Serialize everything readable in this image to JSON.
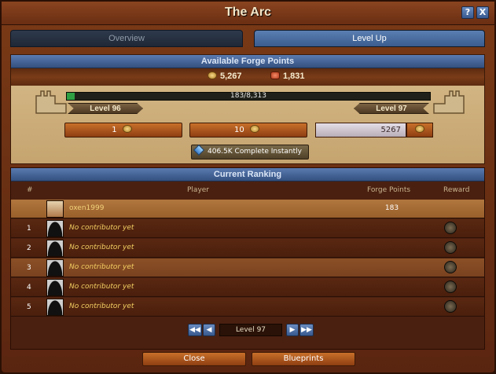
{
  "window": {
    "title": "The Arc",
    "help_label": "?",
    "close_label": "X"
  },
  "tabs": [
    {
      "label": "Overview",
      "active": false
    },
    {
      "label": "Level Up",
      "active": true
    }
  ],
  "forge": {
    "header": "Available Forge Points",
    "forge_points": "5,267",
    "other_points": "1,831",
    "progress_text": "183/8,313",
    "progress_fraction": 0.022,
    "level_current": "Level 96",
    "level_next": "Level 97",
    "btn_one": "1",
    "btn_ten": "10",
    "custom_value": "5267",
    "instant_amount": "406.5K",
    "instant_label": "Complete Instantly"
  },
  "ranking": {
    "header": "Current Ranking",
    "col_rank": "#",
    "col_player": "Player",
    "col_fp": "Forge Points",
    "col_reward": "Reward",
    "rows": [
      {
        "rank": "",
        "player": "oxen1999",
        "fp": "183"
      },
      {
        "rank": "1",
        "player": "No contributor yet",
        "fp": ""
      },
      {
        "rank": "2",
        "player": "No contributor yet",
        "fp": ""
      },
      {
        "rank": "3",
        "player": "No contributor yet",
        "fp": ""
      },
      {
        "rank": "4",
        "player": "No contributor yet",
        "fp": ""
      },
      {
        "rank": "5",
        "player": "No contributor yet",
        "fp": ""
      }
    ],
    "pager_label": "Level 97"
  },
  "footer": {
    "close": "Close",
    "blueprints": "Blueprints"
  },
  "colors": {
    "accent_blue": "#3a5c8e",
    "button_orange": "#c8702a",
    "progress_green": "#2ea043"
  }
}
